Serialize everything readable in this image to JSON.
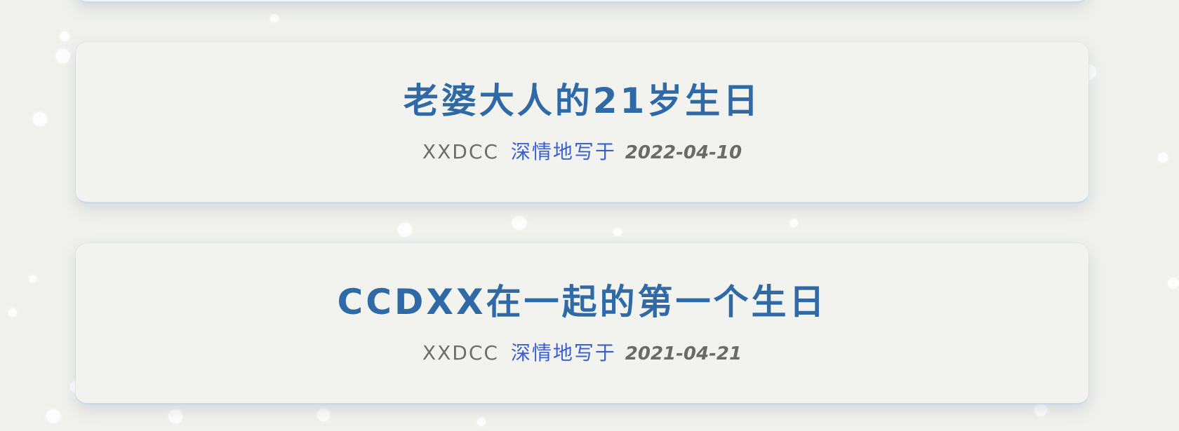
{
  "posts": [
    {
      "title": "老婆大人的21岁生日",
      "author": "XXDCC",
      "action": "深情地写于",
      "date": "2022-04-10"
    },
    {
      "title": "CCDXX在一起的第一个生日",
      "author": "XXDCC",
      "action": "深情地写于",
      "date": "2021-04-21"
    }
  ],
  "colors": {
    "title": "#2f6aa6",
    "author": "#6d6d6d",
    "action": "#3a5fd0",
    "date": "#6a6a6a",
    "background": "#f0f1ed"
  }
}
